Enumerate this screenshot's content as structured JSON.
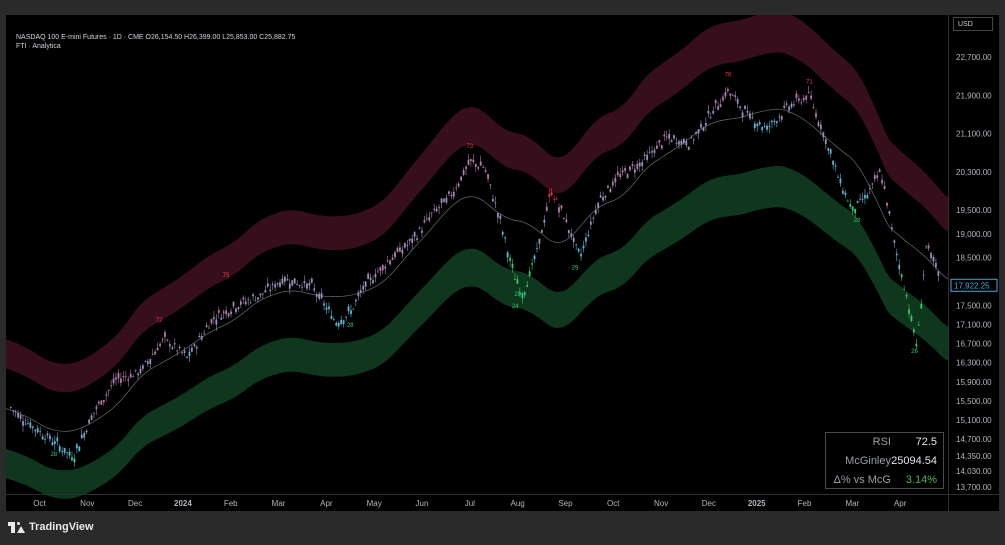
{
  "header": {
    "line1": "NASDAQ 100 E-mini Futures · 1D · CME  O26,154.50  H26,399.00  L25,853.00  C25,882.75",
    "line2": "FTI · Analytica"
  },
  "currency": "USD",
  "stats": [
    {
      "label": "RSI",
      "value": "72.5",
      "color": "#e0e3eb"
    },
    {
      "label": "McGinley",
      "value": "25094.54",
      "color": "#e0e3eb"
    },
    {
      "label": "Δ% vs McG",
      "value": "3.14%",
      "color": "#4caf50"
    }
  ],
  "brand": "TradingView",
  "colors": {
    "upper_band": "#3a0f1c",
    "lower_band": "#0f3a20",
    "overbought": "#ff3344",
    "oversold": "#2ecc71",
    "neutral": "#b07aa8",
    "cool": "#5bb5d5",
    "last_price_box": "#4aa8d8"
  },
  "chart_data": {
    "type": "candlestick",
    "y_axis": {
      "ticks": [
        22700,
        21900,
        21100,
        20300,
        19500,
        19000,
        18500,
        17500,
        17100,
        16700,
        16300,
        15900,
        15500,
        15100,
        14700,
        14350,
        14030,
        13700
      ],
      "labels": [
        "22,700.00",
        "21,900.00",
        "21,100.00",
        "20,300.00",
        "19,500.00",
        "19,000.00",
        "18,500.00",
        "17,500.00",
        "17,100.00",
        "16,700.00",
        "16,300.00",
        "15,900.00",
        "15,500.00",
        "15,100.00",
        "14,700.00",
        "14,350.00",
        "14,030.00",
        "13,700.00"
      ],
      "ylim": [
        13550,
        23500
      ],
      "last_price": 17922.25,
      "last_price_label": "17,922.25"
    },
    "x_axis": {
      "labels": [
        "Oct",
        "Nov",
        "Dec",
        "2024",
        "Feb",
        "Mar",
        "Apr",
        "May",
        "Jun",
        "Jul",
        "Aug",
        "Sep",
        "Oct",
        "Nov",
        "Dec",
        "2025",
        "Feb",
        "Mar",
        "Apr"
      ],
      "bold": [
        false,
        false,
        false,
        true,
        false,
        false,
        false,
        false,
        false,
        false,
        false,
        false,
        false,
        false,
        false,
        true,
        false,
        false,
        false
      ],
      "positions": [
        0.5,
        1.5,
        2.5,
        3.5,
        4.5,
        5.5,
        6.5,
        7.5,
        8.5,
        9.5,
        10.5,
        11.5,
        12.5,
        13.5,
        14.5,
        15.5,
        16.5,
        17.5,
        18.5
      ],
      "xlim": [
        -0.2,
        19.5
      ]
    },
    "price_path": [
      [
        -0.2,
        15450
      ],
      [
        0.3,
        15000
      ],
      [
        0.8,
        14650
      ],
      [
        1.2,
        14300
      ],
      [
        1.6,
        15200
      ],
      [
        2.1,
        15950
      ],
      [
        2.6,
        16100
      ],
      [
        3.1,
        16800
      ],
      [
        3.6,
        16400
      ],
      [
        4.1,
        17200
      ],
      [
        4.6,
        17500
      ],
      [
        5.1,
        17700
      ],
      [
        5.6,
        18050
      ],
      [
        6.2,
        17900
      ],
      [
        6.7,
        17150
      ],
      [
        7.0,
        17350
      ],
      [
        7.3,
        17900
      ],
      [
        7.8,
        18450
      ],
      [
        8.3,
        18850
      ],
      [
        8.7,
        19400
      ],
      [
        9.1,
        19800
      ],
      [
        9.5,
        20500
      ],
      [
        9.8,
        20400
      ],
      [
        10.1,
        19400
      ],
      [
        10.4,
        18200
      ],
      [
        10.6,
        17700
      ],
      [
        10.9,
        18600
      ],
      [
        11.2,
        19900
      ],
      [
        11.5,
        19300
      ],
      [
        11.8,
        18500
      ],
      [
        12.2,
        19700
      ],
      [
        12.6,
        20200
      ],
      [
        13.1,
        20500
      ],
      [
        13.6,
        21000
      ],
      [
        14.1,
        20900
      ],
      [
        14.6,
        21600
      ],
      [
        14.9,
        22000
      ],
      [
        15.3,
        21500
      ],
      [
        15.7,
        21200
      ],
      [
        16.2,
        21700
      ],
      [
        16.6,
        21900
      ],
      [
        16.9,
        21100
      ],
      [
        17.2,
        20200
      ],
      [
        17.5,
        19500
      ],
      [
        17.8,
        19800
      ],
      [
        18.1,
        20300
      ],
      [
        18.4,
        18700
      ],
      [
        18.7,
        17400
      ],
      [
        18.85,
        16600
      ],
      [
        19.05,
        18800
      ],
      [
        19.3,
        18100
      ]
    ],
    "annotations": {
      "oversold_counts": [
        {
          "x": 0.8,
          "y": 14350,
          "t": "28"
        },
        {
          "x": 7.0,
          "y": 17050,
          "t": "28"
        },
        {
          "x": 10.5,
          "y": 17700,
          "t": "29"
        },
        {
          "x": 10.45,
          "y": 17450,
          "t": "24"
        },
        {
          "x": 11.7,
          "y": 18250,
          "t": "29"
        },
        {
          "x": 17.6,
          "y": 19250,
          "t": "28"
        },
        {
          "x": 18.8,
          "y": 16500,
          "t": "26"
        }
      ],
      "overbought_counts": [
        {
          "x": 3.0,
          "y": 17150,
          "t": "72"
        },
        {
          "x": 4.4,
          "y": 18100,
          "t": "75"
        },
        {
          "x": 9.5,
          "y": 20800,
          "t": "73"
        },
        {
          "x": 14.9,
          "y": 22300,
          "t": "76"
        },
        {
          "x": 16.6,
          "y": 22150,
          "t": "71"
        }
      ]
    }
  }
}
